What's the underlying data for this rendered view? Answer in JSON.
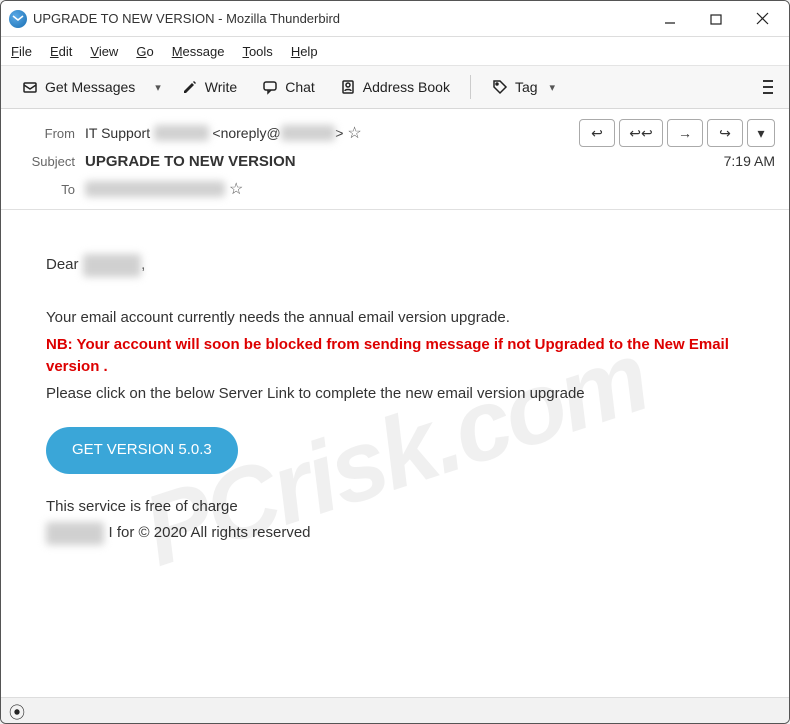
{
  "window": {
    "title": "UPGRADE TO NEW VERSION - Mozilla Thunderbird"
  },
  "menu": {
    "file": "File",
    "edit": "Edit",
    "view": "View",
    "go": "Go",
    "message": "Message",
    "tools": "Tools",
    "help": "Help"
  },
  "toolbar": {
    "get_messages": "Get Messages",
    "write": "Write",
    "chat": "Chat",
    "address_book": "Address Book",
    "tag": "Tag"
  },
  "headers": {
    "from_label": "From",
    "from_name": "IT Support",
    "from_redacted1": "redacted",
    "from_email_prefix": "<noreply@",
    "from_redacted2": "redacted",
    "from_email_suffix": ">",
    "subject_label": "Subject",
    "subject": "UPGRADE TO NEW VERSION",
    "time": "7:19 AM",
    "to_label": "To",
    "to_redacted": "redacted-recipient"
  },
  "body": {
    "greeting_prefix": "Dear ",
    "greeting_redacted": "redacted",
    "greeting_suffix": ",",
    "line1": "Your email account currently needs the annual email version upgrade.",
    "warning": "NB: Your account will soon be blocked from sending message if not Upgraded to the New Email version .",
    "line2": "Please click on the below Server Link  to complete the new email version upgrade",
    "cta": "GET VERSION 5.0.3",
    "foot1": "This service is free of charge",
    "foot2_redacted": "redacted",
    "foot2_rest": " I for © 2020 All rights reserved"
  },
  "watermark": "PCrisk.com"
}
